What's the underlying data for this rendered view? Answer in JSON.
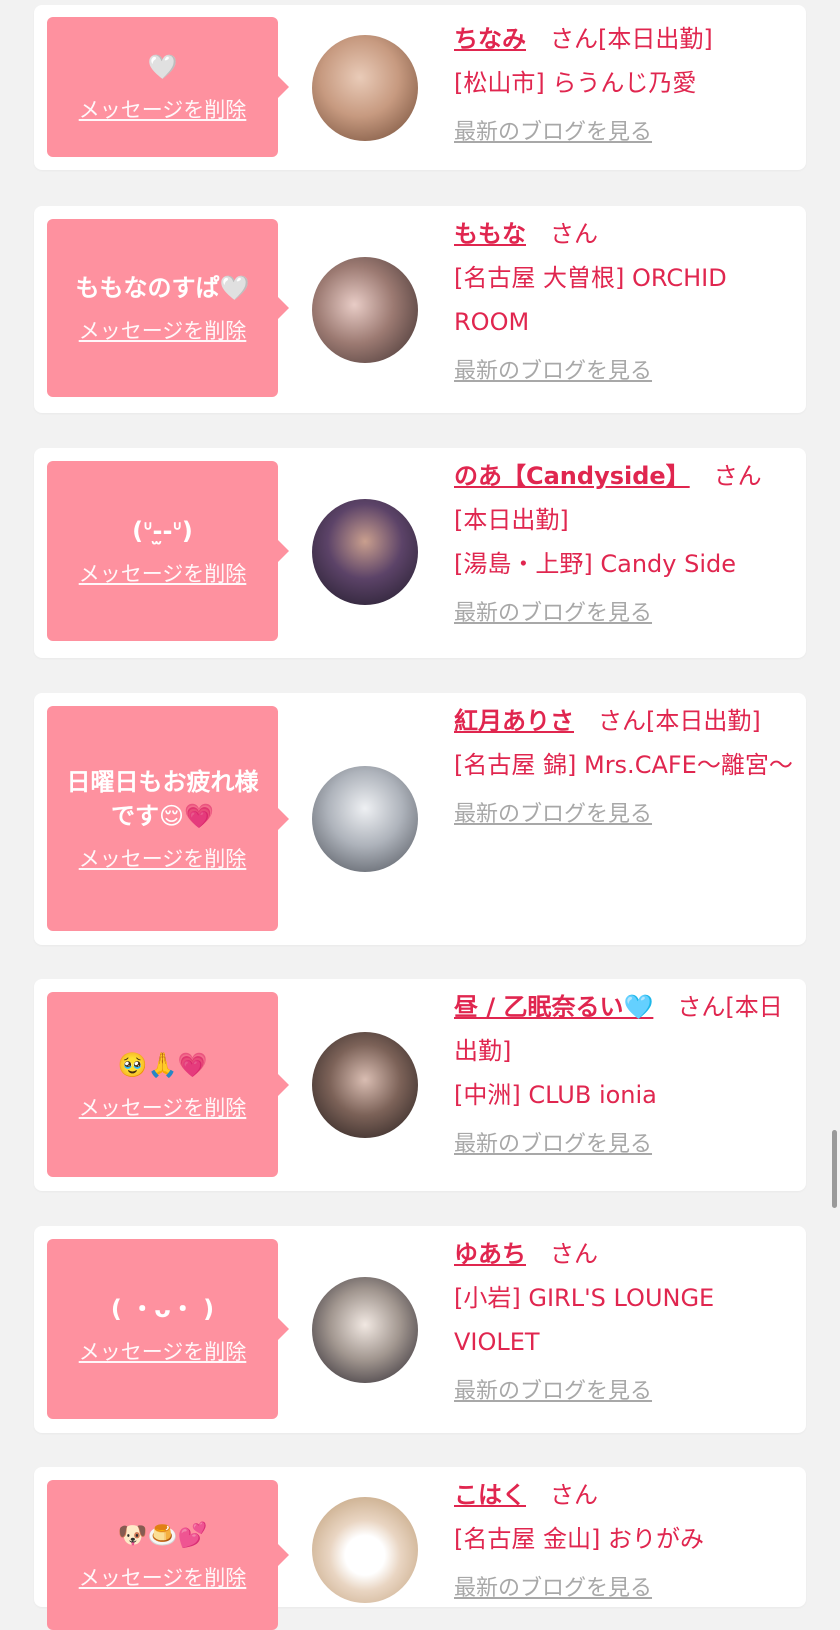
{
  "colors": {
    "accent": "#e0264f",
    "bubble": "#fe919f",
    "link_gray": "#a8a8a8",
    "background": "#f2f2f2"
  },
  "delete_label": "メッセージを削除",
  "san": "さん",
  "blog_label": "最新のブログを見る",
  "cards": [
    {
      "message": "🤍",
      "name": "ちなみ",
      "suffix": "[本日出勤]",
      "shop": "[松山市] らうんじ乃愛",
      "avatar_colors": [
        "#d9b8a3",
        "#8a5a3f"
      ]
    },
    {
      "message": "ももなのすぱ🤍",
      "name": "ももな",
      "suffix": "",
      "shop": "[名古屋 大曽根] ORCHID ROOM",
      "avatar_colors": [
        "#c7a6a3",
        "#4a3a3a"
      ]
    },
    {
      "message": "(ᐡ-̫-ᐡ)",
      "name": "のあ【Candyside】",
      "suffix": "[本日出勤]",
      "shop": "[湯島・上野] Candy Side",
      "avatar_colors": [
        "#7a5a8a",
        "#2a2235"
      ]
    },
    {
      "message": "日曜日もお疲れ様です😌💗",
      "name": "紅月ありさ",
      "suffix": "[本日出勤]",
      "shop": "[名古屋 錦] Mrs.CAFE〜離宮〜",
      "avatar_colors": [
        "#d8dde3",
        "#6b707a"
      ]
    },
    {
      "message": "🥹🙏💗",
      "name": "昼 / 乙眠奈るい🩵",
      "suffix": "[本日出勤]",
      "shop": "[中洲] CLUB ionia",
      "avatar_colors": [
        "#b89a90",
        "#2d2424"
      ]
    },
    {
      "message": "( ・ᴗ・ )",
      "name": "ゆあち",
      "suffix": "",
      "shop": "[小岩] GIRL'S LOUNGE VIOLET",
      "avatar_colors": [
        "#e6dcd6",
        "#2a2328"
      ]
    },
    {
      "message": "🐶🍮💕",
      "name": "こはく",
      "suffix": "",
      "shop": "[名古屋 金山] おりがみ",
      "avatar_colors": [
        "#f0e4d8",
        "#c9a887"
      ]
    }
  ]
}
